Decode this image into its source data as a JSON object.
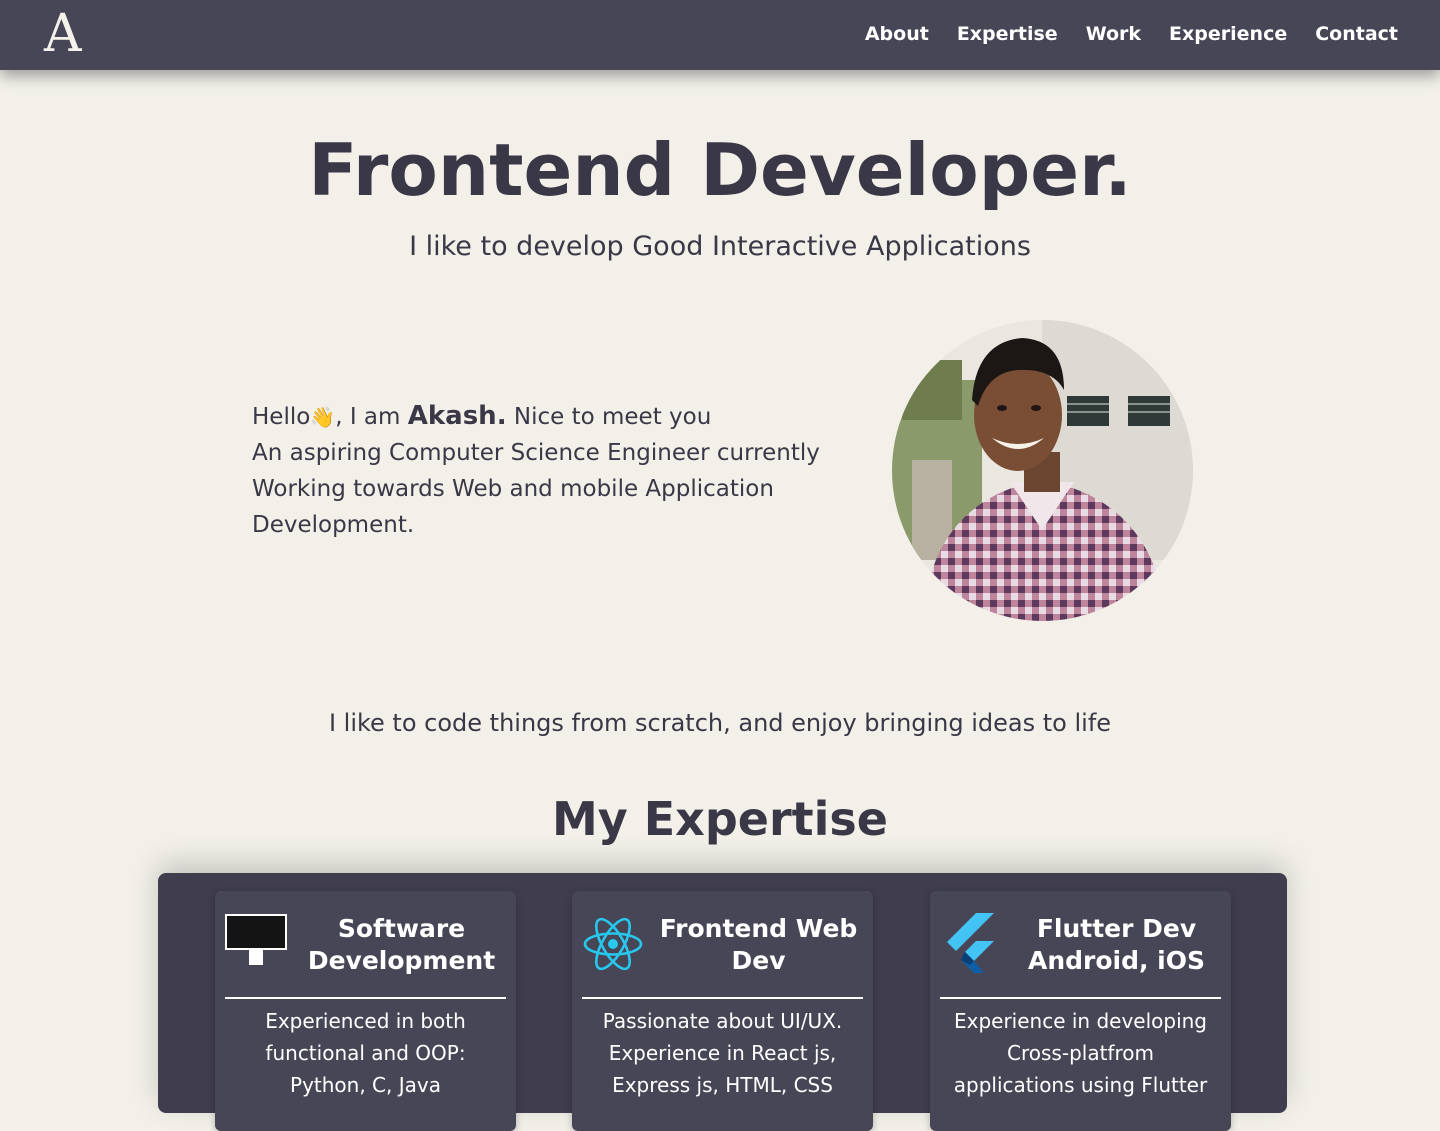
{
  "nav": {
    "logo": "A",
    "links": [
      "About",
      "Expertise",
      "Work",
      "Experience",
      "Contact"
    ]
  },
  "hero": {
    "title": "Frontend Developer.",
    "subtitle": "I like to develop Good Interactive Applications"
  },
  "intro": {
    "hello": "Hello",
    "wave": "👋",
    "iam": ", I am ",
    "name": "Akash.",
    "greeting_end": " Nice to meet you",
    "line2": "An aspiring Computer Science Engineer currently",
    "line3": "Working towards Web and mobile Application",
    "line4": "Development."
  },
  "tagline": "I like to code things from scratch, and enjoy bringing ideas to life",
  "expertise": {
    "title": "My Expertise",
    "cards": [
      {
        "icon": "monitor-icon",
        "title": "Software Development",
        "description": "Experienced in both functional and OOP: Python, C, Java"
      },
      {
        "icon": "react-icon",
        "title": "Frontend Web Dev",
        "description": "Passionate about UI/UX. Experience in React js, Express js, HTML, CSS"
      },
      {
        "icon": "flutter-icon",
        "title": "Flutter Dev Android, iOS",
        "description": "Experience in developing Cross-platfrom applications using Flutter"
      }
    ]
  },
  "colors": {
    "background": "#f2f0e9",
    "navbar": "#474656",
    "text": "#3a3846",
    "panel": "#403e4e",
    "react_accent": "#27c8ee",
    "flutter_accent": "#44c4f4"
  }
}
